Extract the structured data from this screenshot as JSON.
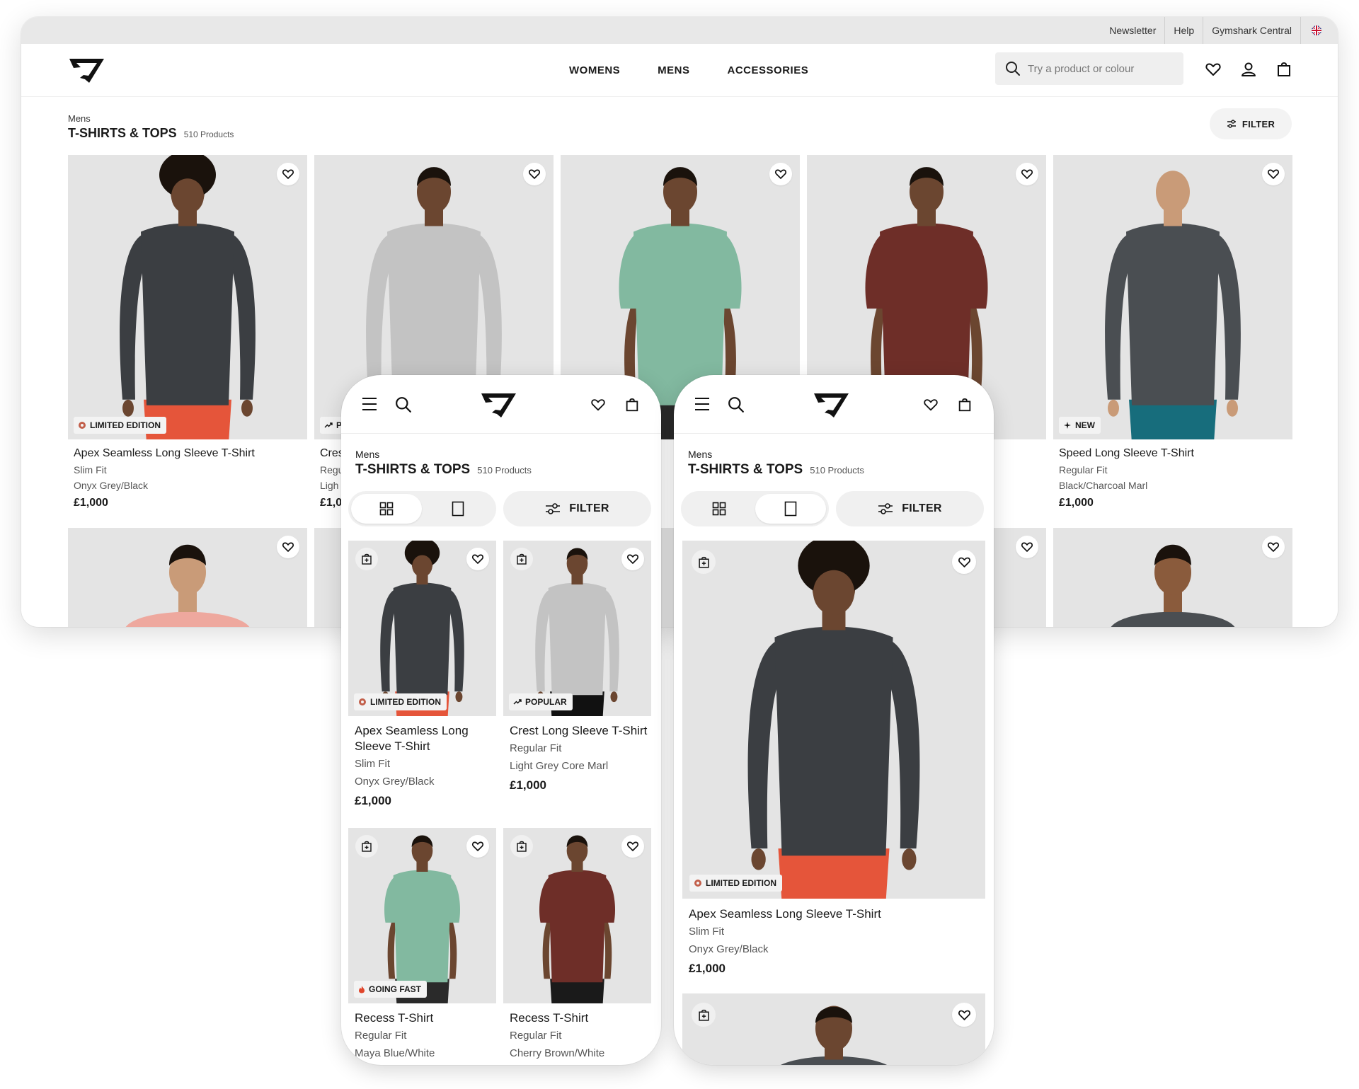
{
  "utility_bar": {
    "links": [
      "Newsletter",
      "Help",
      "Gymshark Central"
    ]
  },
  "nav": {
    "links": [
      "WOMENS",
      "MENS",
      "ACCESSORIES"
    ],
    "search_placeholder": "Try a product or colour"
  },
  "listing": {
    "breadcrumb": "Mens",
    "title": "T-SHIRTS & TOPS",
    "count": "510 Products",
    "filter_label": "FILTER"
  },
  "products": [
    {
      "name": "Apex Seamless Long Sleeve T-Shirt",
      "fit": "Slim Fit",
      "colour": "Onyx Grey/Black",
      "price": "£1,000",
      "badge": "LIMITED EDITION",
      "shirt_color": "#3b3e42",
      "sleeve": "long",
      "bottom_color": "#e5553a",
      "skin": "#6b4630",
      "hair": "afro"
    },
    {
      "name": "Crest Long Sleeve T-Shirt",
      "fit": "Regular Fit",
      "colour": "Light Grey Core Marl",
      "price": "£1,000",
      "badge": "POPULAR",
      "shirt_color": "#c3c3c3",
      "sleeve": "long",
      "bottom_color": "#111111",
      "skin": "#6b4630",
      "hair": "short"
    },
    {
      "name": "Recess T-Shirt",
      "fit": "Regular Fit",
      "colour": "Maya Blue/White",
      "price": "",
      "badge": "GOING FAST",
      "shirt_color": "#82b9a0",
      "sleeve": "short",
      "bottom_color": "#2a2a2a",
      "skin": "#6b4630",
      "hair": "short"
    },
    {
      "name": "Recess T-Shirt",
      "fit": "Regular Fit",
      "colour": "Cherry Brown/White",
      "price": "",
      "badge": "",
      "shirt_color": "#6e2e28",
      "sleeve": "short",
      "bottom_color": "#1a1a1a",
      "skin": "#6b4630",
      "hair": "short"
    },
    {
      "name": "Speed Long Sleeve T-Shirt",
      "fit": "Regular Fit",
      "colour": "Black/Charcoal Marl",
      "price": "£1,000",
      "badge": "NEW",
      "shirt_color": "#4a4e52",
      "sleeve": "long",
      "bottom_color": "#176d7c",
      "skin": "#c99b78",
      "hair": "bald"
    }
  ],
  "desktop_partial_card": {
    "name": "Cres",
    "fit": "Regu",
    "colour": "Ligh",
    "price": "£1,0",
    "badge": "P"
  },
  "row2_colors": [
    "#eea89e",
    "#e4e4e4",
    "#e4e4e4",
    "#e4e4e4",
    "#4a4e52"
  ],
  "mobile": {
    "breadcrumb": "Mens",
    "title": "T-SHIRTS & TOPS",
    "count": "510 Products",
    "filter_label": "FILTER"
  },
  "colors": {
    "background": "#ffffff",
    "image_bg": "#e4e4e4",
    "badge_bg": "#f3f3f3",
    "limited_dot": "#c25f4a",
    "fire": "#e0452b"
  }
}
